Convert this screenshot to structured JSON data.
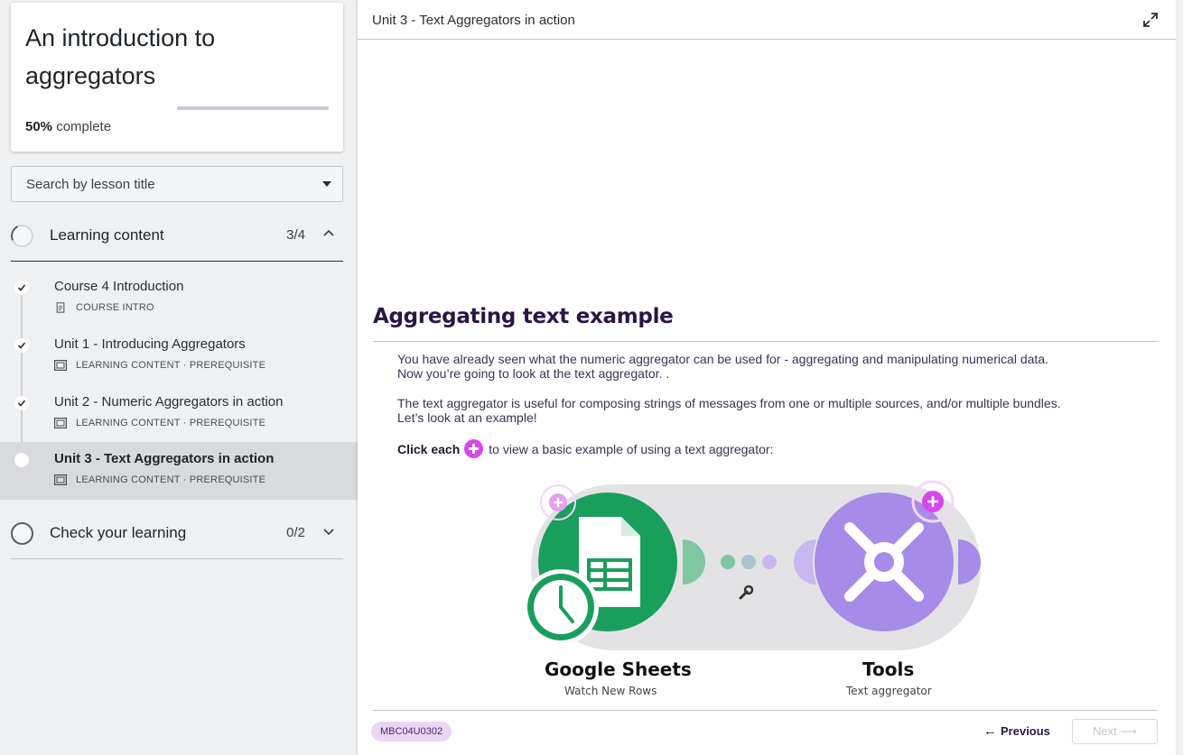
{
  "course": {
    "title": "An introduction to aggregators",
    "progress_value": "50%",
    "progress_label": "complete",
    "progress_fraction": 0.5
  },
  "search": {
    "placeholder": "Search by lesson title"
  },
  "sections": [
    {
      "title": "Learning content",
      "count": "3/4",
      "expanded": true,
      "lessons": [
        {
          "title": "Course 4 Introduction",
          "meta": "COURSE INTRO",
          "completed": true
        },
        {
          "title": "Unit 1 - Introducing Aggregators",
          "meta": "LEARNING CONTENT · PREREQUISITE",
          "completed": true
        },
        {
          "title": "Unit 2 - Numeric Aggregators in action",
          "meta": "LEARNING CONTENT · PREREQUISITE",
          "completed": true
        },
        {
          "title": "Unit 3 - Text Aggregators in action",
          "meta": "LEARNING CONTENT · PREREQUISITE",
          "completed": false,
          "active": true
        }
      ]
    },
    {
      "title": "Check your learning",
      "count": "0/2",
      "expanded": false
    }
  ],
  "main": {
    "topbar_title": "Unit 3 - Text Aggregators in action",
    "heading": "Aggregating text example",
    "para1_line1": "You have already seen what the numeric aggregator can be used for - aggregating and manipulating numerical data.",
    "para1_line2": "Now you’re going to look at the text aggregator. .",
    "para2_line1": "The text aggregator is useful for composing strings of messages from one or multiple sources, and/or multiple bundles.",
    "para2_line2": "Let’s look at an example!",
    "click_lead": "Click each",
    "click_rest": "to view a basic example of using a text aggregator:",
    "diagram": {
      "module1_name": "Google Sheets",
      "module1_sub": "Watch New Rows",
      "module2_name": "Tools",
      "module2_sub": "Text aggregator"
    },
    "footer": {
      "code": "MBC04U0302",
      "previous_label": "Previous",
      "next_label": "Next"
    }
  },
  "colors": {
    "accent_purple": "#d946ef",
    "sheets_green": "#1a9e5c",
    "tools_purple": "#a78be8",
    "heading_purple": "#2a1645"
  }
}
